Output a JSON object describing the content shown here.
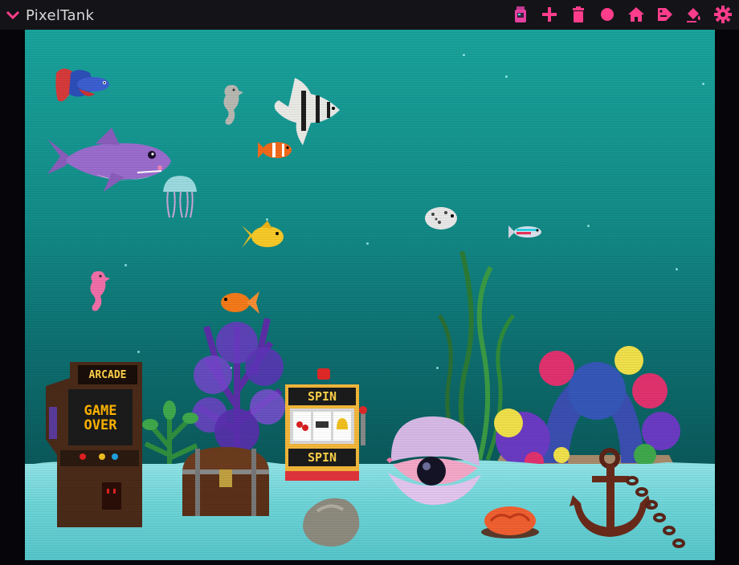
{
  "app": {
    "title": "PixelTank"
  },
  "toolbar": {
    "items": [
      {
        "name": "jar-icon",
        "color": "#e53fa0"
      },
      {
        "name": "add-icon",
        "color": "#ff3d8b"
      },
      {
        "name": "trash-icon",
        "color": "#ff3d8b"
      },
      {
        "name": "record-icon",
        "color": "#ff3d8b"
      },
      {
        "name": "home-icon",
        "color": "#ff3d8b"
      },
      {
        "name": "tag-icon",
        "color": "#ff3d8b"
      },
      {
        "name": "paint-bucket-icon",
        "color": "#ff3d8b"
      },
      {
        "name": "gear-icon",
        "color": "#ff3d8b"
      }
    ]
  },
  "tank": {
    "arcade": {
      "marquee": "ARCADE",
      "screen_line1": "GAME",
      "screen_line2": "OVER"
    },
    "slot_machine": {
      "top_label": "SPIN",
      "bottom_label": "SPIN",
      "reels": [
        "cherry",
        "BAR",
        "bell"
      ]
    }
  },
  "colors": {
    "accent": "#ff3d8b",
    "water_top": "#1aa39c",
    "water_bottom": "#0a4d50",
    "sand": "#6fd5d8"
  }
}
